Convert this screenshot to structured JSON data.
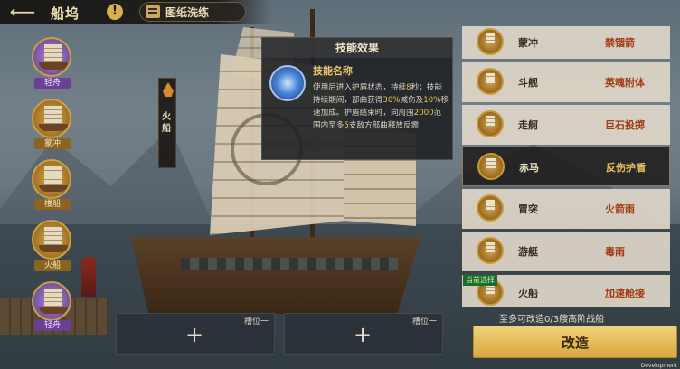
{
  "header": {
    "title": "船坞",
    "help_label": "!",
    "tab_label": "图纸洗练",
    "back_icon": "arrow-left-icon"
  },
  "ship_list": [
    {
      "label": "轻舟",
      "tier": "purple"
    },
    {
      "label": "蒙冲",
      "tier": "gold"
    },
    {
      "label": "楼船",
      "tier": "gold"
    },
    {
      "label": "火船",
      "tier": "gold"
    },
    {
      "label": "轻舟",
      "tier": "purple"
    }
  ],
  "current_ship_tag": "火船",
  "skill_popup": {
    "header": "技能效果",
    "name": "技能名称",
    "desc_1": "使用后进入护盾状态，持续",
    "val_1": "8",
    "desc_2": "秒；技能持续期间，部曲获得",
    "val_2": "30%",
    "desc_3": "减伤及",
    "val_3": "10%",
    "desc_4": "移速加成。护盾结束时，向周围",
    "val_4": "2000",
    "desc_5": "范围内至多",
    "val_5": "5",
    "desc_6": "支敌方部曲释放反震"
  },
  "skill_list": [
    {
      "ship": "蒙冲",
      "skill": "禁锢箭"
    },
    {
      "ship": "斗舰",
      "skill": "英魂附体"
    },
    {
      "ship": "走舸",
      "skill": "巨石投掷"
    },
    {
      "ship": "赤马",
      "skill": "反伤护盾"
    },
    {
      "ship": "冒突",
      "skill": "火箭雨"
    },
    {
      "ship": "游艇",
      "skill": "毒雨"
    },
    {
      "ship": "火船",
      "skill": "加速舱接"
    }
  ],
  "current_badge": "当前选择",
  "slots": [
    {
      "title": "槽位一",
      "plus": "+"
    },
    {
      "title": "槽位一",
      "plus": "+"
    }
  ],
  "hint": "至多可改造0/3艘高阶战船",
  "modify_button": "改造",
  "dev_label": "Development",
  "colors": {
    "accent_gold": "#d9a840",
    "skill_highlight": "#e8c24a",
    "skill_name_red": "#a23a14"
  }
}
